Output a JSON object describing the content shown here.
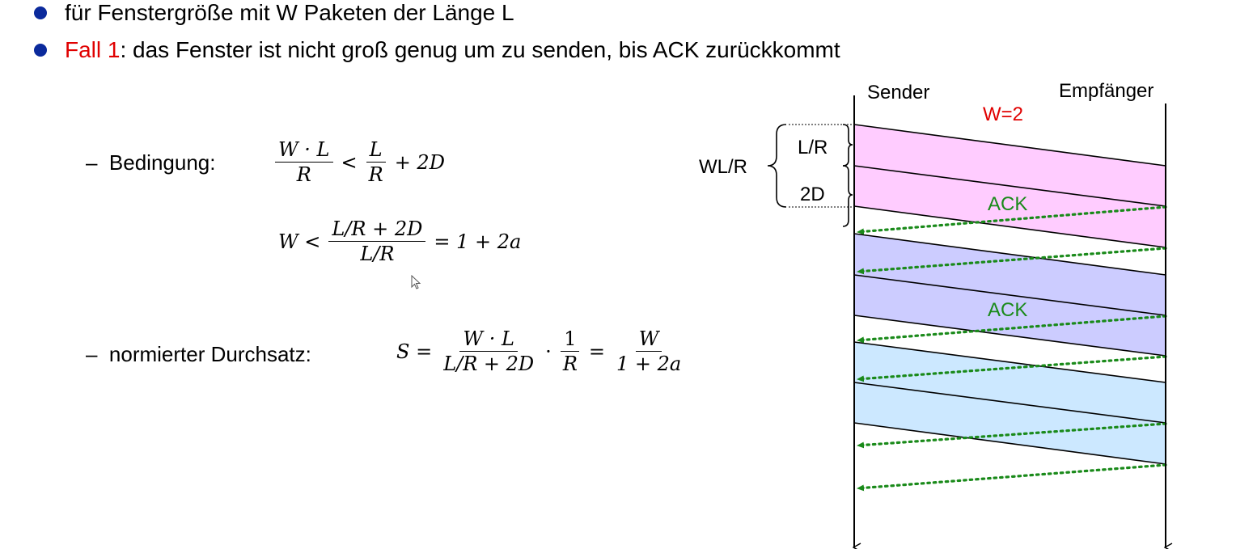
{
  "bullets": {
    "b1": "für Fenstergröße mit W Paketen der Länge L",
    "b2_prefix": "Fall 1",
    "b2_rest": ": das Fenster ist nicht groß genug um zu senden, bis ACK zurückkommt"
  },
  "bedingung": {
    "label": "Bedingung:",
    "eq1": {
      "num1": "W · L",
      "den1": "R",
      "op": "<",
      "num2": "L",
      "den2": "R",
      "tail": "+ 2D"
    },
    "eq2": {
      "lhs": "W <",
      "num": "L/R + 2D",
      "den": "L/R",
      "rhs": "= 1 + 2a"
    }
  },
  "durchsatz": {
    "label": "normierter Durchsatz:",
    "eq": {
      "lhs": "S =",
      "num1": "W · L",
      "den1": "L/R + 2D",
      "dot": "·",
      "num2": "1",
      "den2": "R",
      "eq": "=",
      "num3": "W",
      "den3": "1 + 2a"
    }
  },
  "diagram": {
    "sender": "Sender",
    "receiver": "Empfänger",
    "window": "W=2",
    "wlr": "WL/R",
    "lr": "L/R",
    "twod": "2D",
    "ack1": "ACK",
    "ack2": "ACK",
    "colors": {
      "pink": "#ffccff",
      "purple": "#ccccff",
      "lightblue": "#cce8ff",
      "ack": "#1a8a1a",
      "red": "#e00000"
    }
  }
}
